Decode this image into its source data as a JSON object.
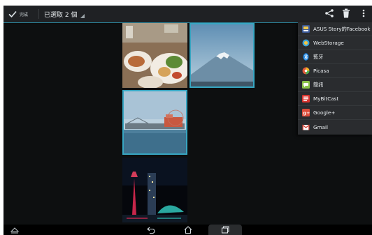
{
  "action_bar": {
    "done_label": "完成",
    "selection_label": "已選取 2 個"
  },
  "icons": {
    "done": "check-icon",
    "selection_dropdown": "caret-icon",
    "share": "share-icon",
    "delete": "trash-icon",
    "overflow": "more-vert-icon",
    "nav_collapse": "chevron-up-icon",
    "nav_back": "back-icon",
    "nav_home": "home-icon",
    "nav_recents": "recents-icon"
  },
  "gallery": {
    "thumbnails": [
      {
        "subject": "food",
        "selected": false
      },
      {
        "subject": "mountain",
        "selected": true
      },
      {
        "subject": "harbor",
        "selected": true
      },
      {
        "subject": "night-tower",
        "selected": false
      }
    ]
  },
  "share_menu": {
    "items": [
      {
        "label": "ASUS Story的Facebook",
        "icon": "asus-story-icon",
        "color": "#3b5998"
      },
      {
        "label": "WebStorage",
        "icon": "webstorage-icon",
        "color": "#3ba3d8"
      },
      {
        "label": "藍牙",
        "icon": "bluetooth-icon",
        "color": "#1e88e5"
      },
      {
        "label": "Picasa",
        "icon": "picasa-icon",
        "color": "#e35a3b"
      },
      {
        "label": "簡訊",
        "icon": "messaging-icon",
        "color": "#8bc34a"
      },
      {
        "label": "MyBitCast",
        "icon": "mybitcast-icon",
        "color": "#d8342f"
      },
      {
        "label": "Google+",
        "icon": "google-plus-icon",
        "color": "#dd4b39"
      },
      {
        "label": "Gmail",
        "icon": "gmail-icon",
        "color": "#d23f31"
      }
    ]
  },
  "colors": {
    "accent": "#37a6c2",
    "action_bar": "#1f2124",
    "menu_bg": "#2a2c2f",
    "background": "#0d0f10"
  }
}
